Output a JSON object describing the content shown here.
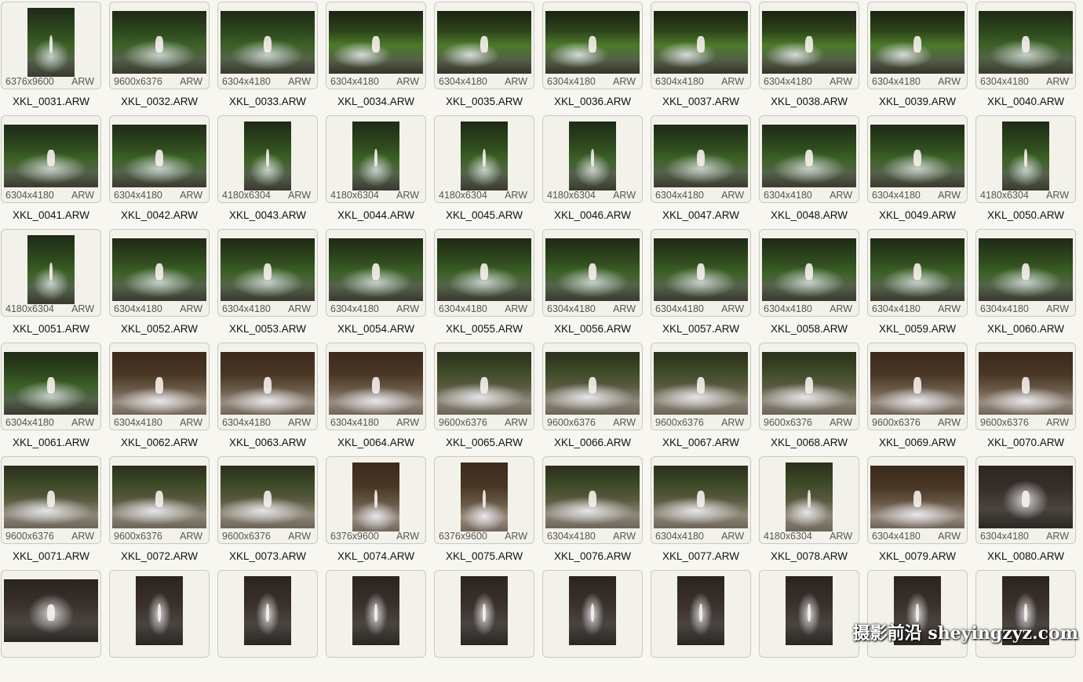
{
  "thumbnails": [
    {
      "file": "XKL_0031.ARW",
      "dims": "6376x9600",
      "type": "ARW",
      "orient": "port",
      "scene": "s-forest"
    },
    {
      "file": "XKL_0032.ARW",
      "dims": "9600x6376",
      "type": "ARW",
      "orient": "land",
      "scene": "s-forest"
    },
    {
      "file": "XKL_0033.ARW",
      "dims": "6304x4180",
      "type": "ARW",
      "orient": "land",
      "scene": "s-forest"
    },
    {
      "file": "XKL_0034.ARW",
      "dims": "6304x4180",
      "type": "ARW",
      "orient": "land",
      "scene": "s-forest2"
    },
    {
      "file": "XKL_0035.ARW",
      "dims": "6304x4180",
      "type": "ARW",
      "orient": "land",
      "scene": "s-forest2"
    },
    {
      "file": "XKL_0036.ARW",
      "dims": "6304x4180",
      "type": "ARW",
      "orient": "land",
      "scene": "s-forest2"
    },
    {
      "file": "XKL_0037.ARW",
      "dims": "6304x4180",
      "type": "ARW",
      "orient": "land",
      "scene": "s-forest2"
    },
    {
      "file": "XKL_0038.ARW",
      "dims": "6304x4180",
      "type": "ARW",
      "orient": "land",
      "scene": "s-forest2"
    },
    {
      "file": "XKL_0039.ARW",
      "dims": "6304x4180",
      "type": "ARW",
      "orient": "land",
      "scene": "s-forest2"
    },
    {
      "file": "XKL_0040.ARW",
      "dims": "6304x4180",
      "type": "ARW",
      "orient": "land",
      "scene": "s-forest"
    },
    {
      "file": "XKL_0041.ARW",
      "dims": "6304x4180",
      "type": "ARW",
      "orient": "land",
      "scene": "s-forest"
    },
    {
      "file": "XKL_0042.ARW",
      "dims": "6304x4180",
      "type": "ARW",
      "orient": "land",
      "scene": "s-forest"
    },
    {
      "file": "XKL_0043.ARW",
      "dims": "4180x6304",
      "type": "ARW",
      "orient": "port",
      "scene": "s-forest"
    },
    {
      "file": "XKL_0044.ARW",
      "dims": "4180x6304",
      "type": "ARW",
      "orient": "port",
      "scene": "s-forest"
    },
    {
      "file": "XKL_0045.ARW",
      "dims": "4180x6304",
      "type": "ARW",
      "orient": "port",
      "scene": "s-forest"
    },
    {
      "file": "XKL_0046.ARW",
      "dims": "4180x6304",
      "type": "ARW",
      "orient": "port",
      "scene": "s-forest"
    },
    {
      "file": "XKL_0047.ARW",
      "dims": "6304x4180",
      "type": "ARW",
      "orient": "land",
      "scene": "s-forest"
    },
    {
      "file": "XKL_0048.ARW",
      "dims": "6304x4180",
      "type": "ARW",
      "orient": "land",
      "scene": "s-forest"
    },
    {
      "file": "XKL_0049.ARW",
      "dims": "6304x4180",
      "type": "ARW",
      "orient": "land",
      "scene": "s-forest"
    },
    {
      "file": "XKL_0050.ARW",
      "dims": "4180x6304",
      "type": "ARW",
      "orient": "port",
      "scene": "s-forest"
    },
    {
      "file": "XKL_0051.ARW",
      "dims": "4180x6304",
      "type": "ARW",
      "orient": "port",
      "scene": "s-forest"
    },
    {
      "file": "XKL_0052.ARW",
      "dims": "6304x4180",
      "type": "ARW",
      "orient": "land",
      "scene": "s-forest"
    },
    {
      "file": "XKL_0053.ARW",
      "dims": "6304x4180",
      "type": "ARW",
      "orient": "land",
      "scene": "s-forest"
    },
    {
      "file": "XKL_0054.ARW",
      "dims": "6304x4180",
      "type": "ARW",
      "orient": "land",
      "scene": "s-forest"
    },
    {
      "file": "XKL_0055.ARW",
      "dims": "6304x4180",
      "type": "ARW",
      "orient": "land",
      "scene": "s-forest"
    },
    {
      "file": "XKL_0056.ARW",
      "dims": "6304x4180",
      "type": "ARW",
      "orient": "land",
      "scene": "s-forest"
    },
    {
      "file": "XKL_0057.ARW",
      "dims": "6304x4180",
      "type": "ARW",
      "orient": "land",
      "scene": "s-forest"
    },
    {
      "file": "XKL_0058.ARW",
      "dims": "6304x4180",
      "type": "ARW",
      "orient": "land",
      "scene": "s-forest"
    },
    {
      "file": "XKL_0059.ARW",
      "dims": "6304x4180",
      "type": "ARW",
      "orient": "land",
      "scene": "s-forest"
    },
    {
      "file": "XKL_0060.ARW",
      "dims": "6304x4180",
      "type": "ARW",
      "orient": "land",
      "scene": "s-forest"
    },
    {
      "file": "XKL_0061.ARW",
      "dims": "6304x4180",
      "type": "ARW",
      "orient": "land",
      "scene": "s-forest"
    },
    {
      "file": "XKL_0062.ARW",
      "dims": "6304x4180",
      "type": "ARW",
      "orient": "land",
      "scene": "s-fog"
    },
    {
      "file": "XKL_0063.ARW",
      "dims": "6304x4180",
      "type": "ARW",
      "orient": "land",
      "scene": "s-fog"
    },
    {
      "file": "XKL_0064.ARW",
      "dims": "6304x4180",
      "type": "ARW",
      "orient": "land",
      "scene": "s-fog"
    },
    {
      "file": "XKL_0065.ARW",
      "dims": "9600x6376",
      "type": "ARW",
      "orient": "land",
      "scene": "s-fog2"
    },
    {
      "file": "XKL_0066.ARW",
      "dims": "9600x6376",
      "type": "ARW",
      "orient": "land",
      "scene": "s-fog2"
    },
    {
      "file": "XKL_0067.ARW",
      "dims": "9600x6376",
      "type": "ARW",
      "orient": "land",
      "scene": "s-fog2"
    },
    {
      "file": "XKL_0068.ARW",
      "dims": "9600x6376",
      "type": "ARW",
      "orient": "land",
      "scene": "s-fog2"
    },
    {
      "file": "XKL_0069.ARW",
      "dims": "9600x6376",
      "type": "ARW",
      "orient": "land",
      "scene": "s-fog"
    },
    {
      "file": "XKL_0070.ARW",
      "dims": "9600x6376",
      "type": "ARW",
      "orient": "land",
      "scene": "s-fog"
    },
    {
      "file": "XKL_0071.ARW",
      "dims": "9600x6376",
      "type": "ARW",
      "orient": "land",
      "scene": "s-fog2"
    },
    {
      "file": "XKL_0072.ARW",
      "dims": "9600x6376",
      "type": "ARW",
      "orient": "land",
      "scene": "s-fog2"
    },
    {
      "file": "XKL_0073.ARW",
      "dims": "9600x6376",
      "type": "ARW",
      "orient": "land",
      "scene": "s-fog2"
    },
    {
      "file": "XKL_0074.ARW",
      "dims": "6376x9600",
      "type": "ARW",
      "orient": "port",
      "scene": "s-fog"
    },
    {
      "file": "XKL_0075.ARW",
      "dims": "6376x9600",
      "type": "ARW",
      "orient": "port",
      "scene": "s-fog"
    },
    {
      "file": "XKL_0076.ARW",
      "dims": "6304x4180",
      "type": "ARW",
      "orient": "land",
      "scene": "s-fog2"
    },
    {
      "file": "XKL_0077.ARW",
      "dims": "6304x4180",
      "type": "ARW",
      "orient": "land",
      "scene": "s-fog2"
    },
    {
      "file": "XKL_0078.ARW",
      "dims": "4180x6304",
      "type": "ARW",
      "orient": "port",
      "scene": "s-fog2"
    },
    {
      "file": "XKL_0079.ARW",
      "dims": "6304x4180",
      "type": "ARW",
      "orient": "land",
      "scene": "s-fog"
    },
    {
      "file": "XKL_0080.ARW",
      "dims": "6304x4180",
      "type": "ARW",
      "orient": "land",
      "scene": "s-dark"
    },
    {
      "file": "",
      "dims": "",
      "type": "",
      "orient": "land",
      "scene": "s-dark"
    },
    {
      "file": "",
      "dims": "",
      "type": "",
      "orient": "port",
      "scene": "s-dark"
    },
    {
      "file": "",
      "dims": "",
      "type": "",
      "orient": "port",
      "scene": "s-dark"
    },
    {
      "file": "",
      "dims": "",
      "type": "",
      "orient": "port",
      "scene": "s-dark"
    },
    {
      "file": "",
      "dims": "",
      "type": "",
      "orient": "port",
      "scene": "s-dark"
    },
    {
      "file": "",
      "dims": "",
      "type": "",
      "orient": "port",
      "scene": "s-dark"
    },
    {
      "file": "",
      "dims": "",
      "type": "",
      "orient": "port",
      "scene": "s-dark"
    },
    {
      "file": "",
      "dims": "",
      "type": "",
      "orient": "port",
      "scene": "s-dark"
    },
    {
      "file": "",
      "dims": "",
      "type": "",
      "orient": "port",
      "scene": "s-dark"
    },
    {
      "file": "",
      "dims": "",
      "type": "",
      "orient": "port",
      "scene": "s-dark"
    }
  ],
  "watermark": "摄影前沿 sheyingzyz.com"
}
